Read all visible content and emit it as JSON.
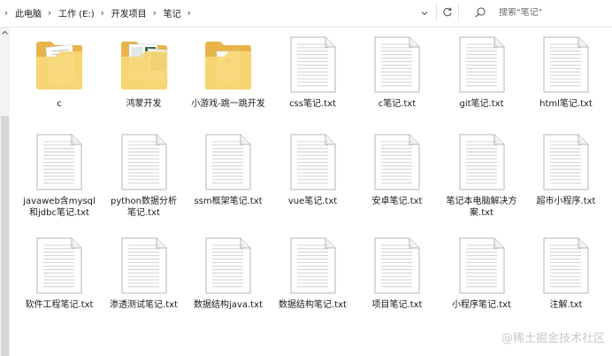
{
  "address_bar": {
    "breadcrumbs": [
      "此电脑",
      "工作 (E:)",
      "开发项目",
      "笔记"
    ],
    "separator_icon": "chevron-right-icon",
    "dropdown_icon": "chevron-down-icon"
  },
  "refresh_icon": "refresh-icon",
  "search": {
    "placeholder": "搜索\"笔记\"",
    "icon": "search-icon"
  },
  "items": [
    {
      "name": "c",
      "type": "folder",
      "preview": "document-thumbs"
    },
    {
      "name": "鸿蒙开发",
      "type": "folder",
      "preview": "screenshot-thumbs"
    },
    {
      "name": "小游戏-跳一跳开发",
      "type": "folder",
      "preview": "app-thumb"
    },
    {
      "name": "css笔记.txt",
      "type": "txt"
    },
    {
      "name": "c笔记.txt",
      "type": "txt"
    },
    {
      "name": "git笔记.txt",
      "type": "txt"
    },
    {
      "name": "html笔记.txt",
      "type": "txt"
    },
    {
      "name": "javaweb含mysql和jdbc笔记.txt",
      "type": "txt"
    },
    {
      "name": "python数据分析笔记.txt",
      "type": "txt"
    },
    {
      "name": "ssm框架笔记.txt",
      "type": "txt"
    },
    {
      "name": "vue笔记.txt",
      "type": "txt"
    },
    {
      "name": "安卓笔记.txt",
      "type": "txt"
    },
    {
      "name": "笔记本电脑解决方案.txt",
      "type": "txt"
    },
    {
      "name": "超市小程序.txt",
      "type": "txt"
    },
    {
      "name": "软件工程笔记.txt",
      "type": "txt"
    },
    {
      "name": "渗透测试笔记.txt",
      "type": "txt"
    },
    {
      "name": "数据结构java.txt",
      "type": "txt"
    },
    {
      "name": "数据结构笔记.txt",
      "type": "txt"
    },
    {
      "name": "项目笔记.txt",
      "type": "txt"
    },
    {
      "name": "小程序笔记.txt",
      "type": "txt"
    },
    {
      "name": "注解.txt",
      "type": "txt"
    }
  ],
  "watermark": "@稀土掘金技术社区",
  "colors": {
    "folder_back": "#e8b44a",
    "folder_front": "#f8d775",
    "file_outline": "#b5b5b5",
    "file_lines": "#c6c6c6"
  }
}
